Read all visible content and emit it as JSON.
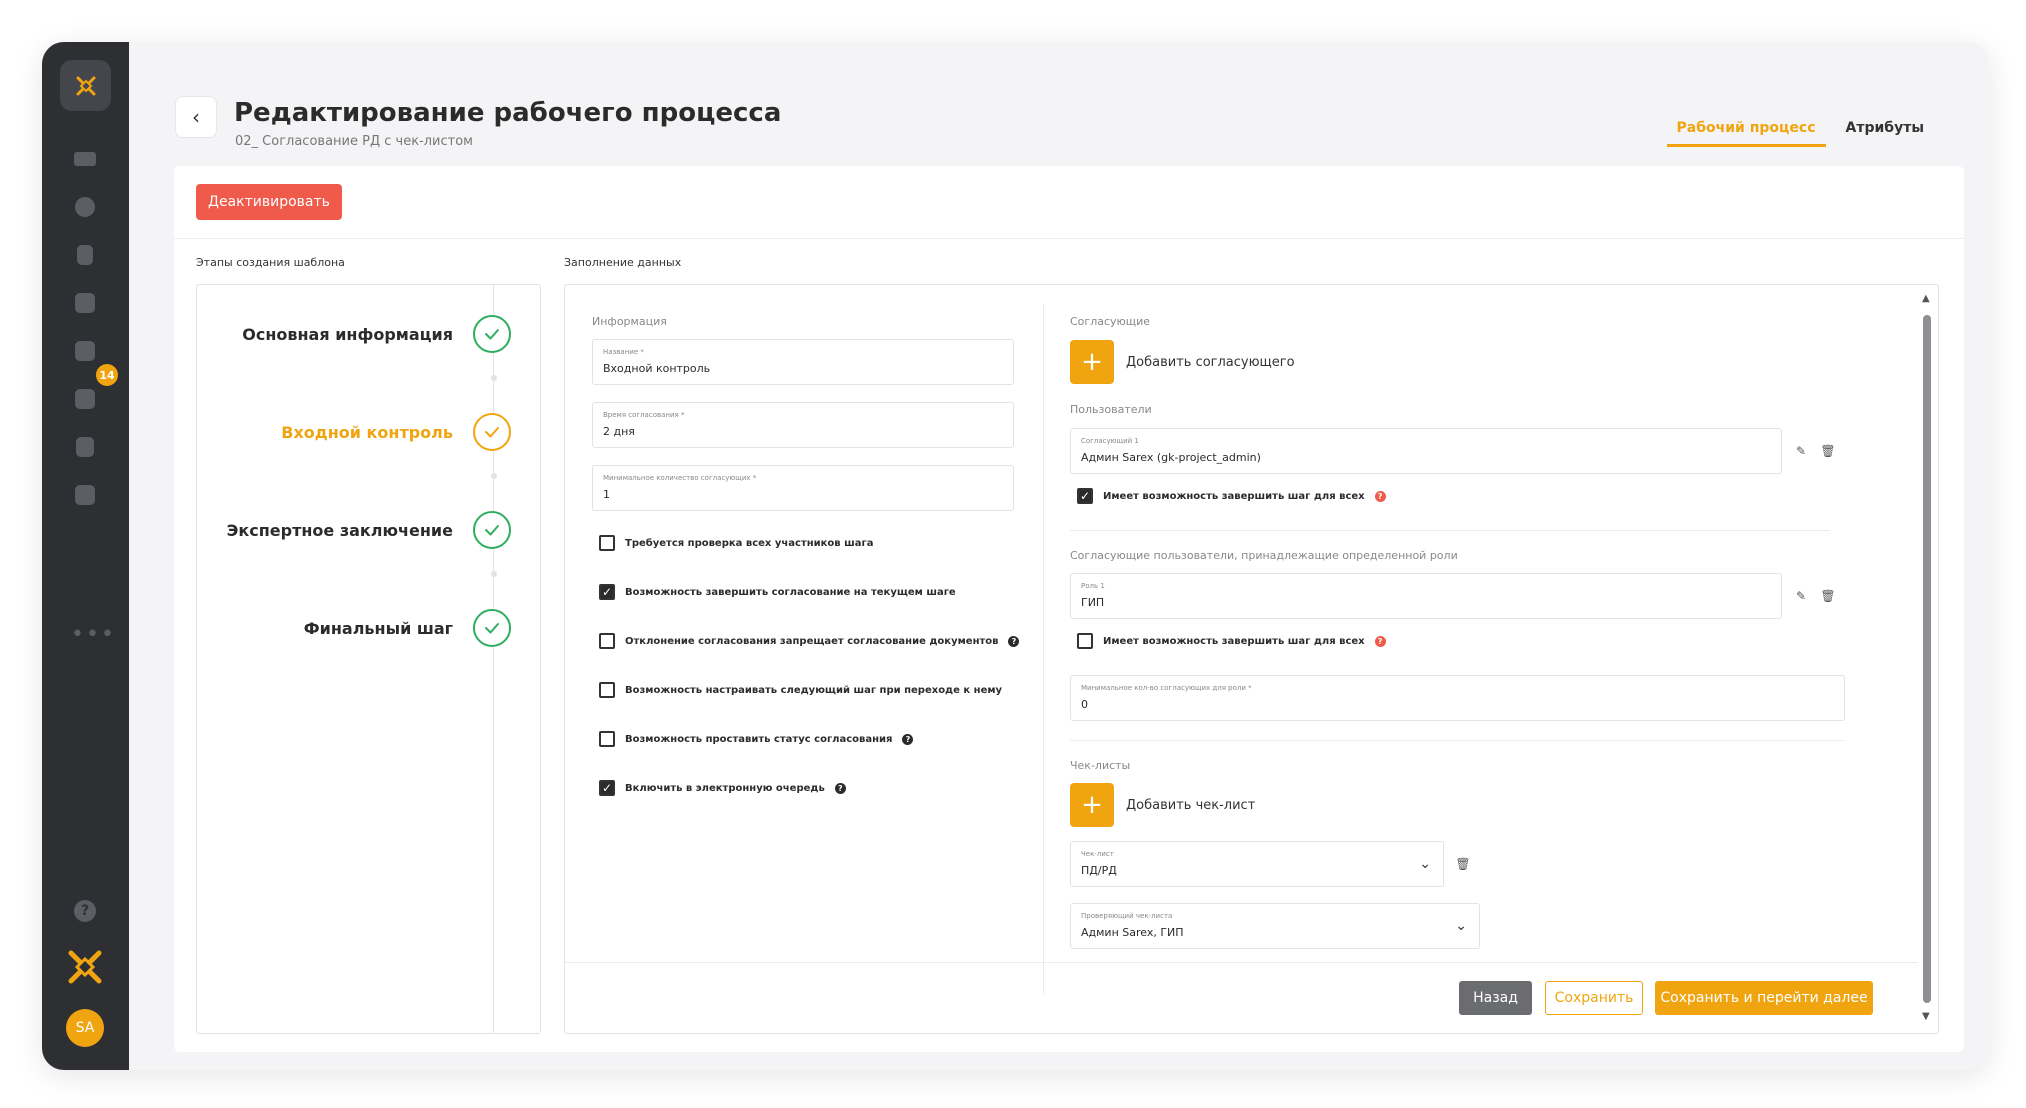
{
  "sidebar": {
    "badge_count": "14",
    "avatar_initials": "SA",
    "more_label": "•••",
    "help_label": "?"
  },
  "header": {
    "title": "Редактирование рабочего процесса",
    "subtitle": "02_ Согласование РД с чек-листом",
    "tabs": [
      {
        "label": "Рабочий процесс",
        "active": true
      },
      {
        "label": "Атрибуты",
        "active": false
      }
    ]
  },
  "toolbar": {
    "deactivate_label": "Деактивировать"
  },
  "steps": {
    "section_label": "Этапы создания шаблона",
    "items": [
      {
        "label": "Основная информация",
        "active": false
      },
      {
        "label": "Входной контроль",
        "active": true
      },
      {
        "label": "Экспертное заключение",
        "active": false
      },
      {
        "label": "Финальный шаг",
        "active": false
      }
    ]
  },
  "form": {
    "section_label": "Заполнение данных",
    "info_label": "Информация",
    "fields": {
      "name": {
        "label": "Название *",
        "value": "Входной контроль"
      },
      "time": {
        "label": "Время согласования *",
        "value": "2 дня"
      },
      "min_count": {
        "label": "Минимальное количество согласующих *",
        "value": "1"
      }
    },
    "checkboxes": [
      {
        "label": "Требуется проверка всех участников шага",
        "checked": false,
        "help": false
      },
      {
        "label": "Возможность завершить согласование на текущем шаге",
        "checked": true,
        "help": false
      },
      {
        "label": "Отклонение согласования запрещает согласование документов",
        "checked": false,
        "help": true
      },
      {
        "label": "Возможность настраивать следующий шаг при переходе к нему",
        "checked": false,
        "help": false
      },
      {
        "label": "Возможность проставить статус согласования",
        "checked": false,
        "help": true
      },
      {
        "label": "Включить в электронную очередь",
        "checked": true,
        "help": true
      }
    ],
    "approvers": {
      "section_label": "Согласующие",
      "add_label": "Добавить согласующего",
      "users_label": "Пользователи",
      "user_field": {
        "label": "Согласующий 1",
        "value": "Админ Sarex (gk-project_admin)"
      },
      "user_can_finish": {
        "label": "Имеет возможность завершить шаг для всех",
        "checked": true
      },
      "roles_label": "Согласующие пользователи, принадлежащие определенной роли",
      "role_field": {
        "label": "Роль 1",
        "value": "ГИП"
      },
      "role_can_finish": {
        "label": "Имеет возможность завершить шаг для всех",
        "checked": false
      },
      "min_role_field": {
        "label": "Минимальное кол-во согласующих для роли *",
        "value": "0"
      }
    },
    "checklists": {
      "section_label": "Чек-листы",
      "add_label": "Добавить чек-лист",
      "checklist_field": {
        "label": "Чек-лист",
        "value": "ПД/РД"
      },
      "reviewer_field": {
        "label": "Проверяющий чек-листа",
        "value": "Админ Sarex, ГИП"
      }
    },
    "buttons": {
      "back": "Назад",
      "save": "Сохранить",
      "save_next": "Сохранить и перейти далее"
    }
  },
  "colors": {
    "accent": "#f0a510",
    "danger": "#f05a4a",
    "success": "#2fae5f",
    "sidebar_bg": "#2d2f33"
  }
}
